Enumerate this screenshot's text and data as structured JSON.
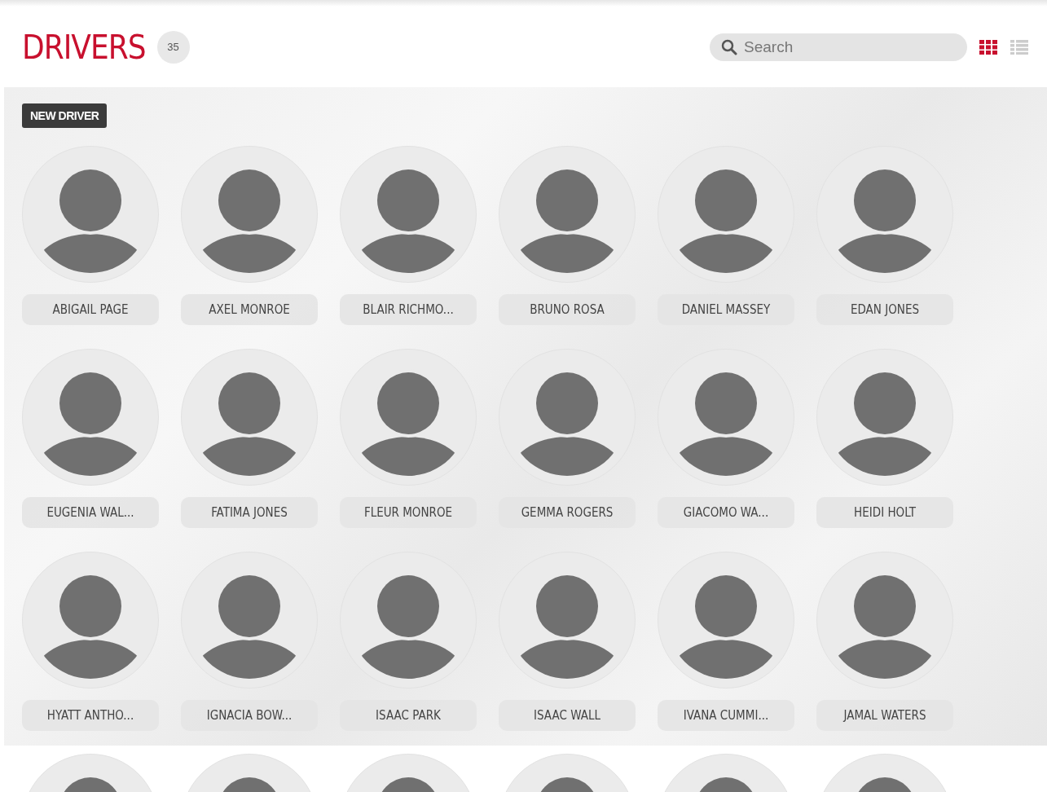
{
  "header": {
    "title": "DRIVERS",
    "count": "35",
    "search": {
      "placeholder": "Search"
    },
    "views": [
      {
        "kind": "grid",
        "selected": true
      },
      {
        "kind": "list",
        "selected": false
      }
    ]
  },
  "toolbar": {
    "new_button": "NEW DRIVER"
  },
  "drivers": [
    {
      "name": "ABIGAIL PAGE"
    },
    {
      "name": "AXEL MONROE"
    },
    {
      "name": "BLAIR RICHMO..."
    },
    {
      "name": "BRUNO ROSA"
    },
    {
      "name": "DANIEL MASSEY"
    },
    {
      "name": "EDAN JONES"
    },
    {
      "name": "EUGENIA WAL..."
    },
    {
      "name": "FATIMA JONES"
    },
    {
      "name": "FLEUR MONROE"
    },
    {
      "name": "GEMMA ROGERS"
    },
    {
      "name": "GIACOMO WA..."
    },
    {
      "name": "HEIDI HOLT"
    },
    {
      "name": "HYATT ANTHO..."
    },
    {
      "name": "IGNACIA BOW..."
    },
    {
      "name": "ISAAC PARK"
    },
    {
      "name": "ISAAC WALL"
    },
    {
      "name": "IVANA CUMMI..."
    },
    {
      "name": "JAMAL WATERS"
    }
  ],
  "more_drivers": [
    {
      "kind": "avatar"
    },
    {
      "kind": "avatar"
    },
    {
      "kind": "avatar"
    },
    {
      "kind": "avatar"
    },
    {
      "kind": "avatar"
    },
    {
      "kind": "avatar"
    }
  ]
}
